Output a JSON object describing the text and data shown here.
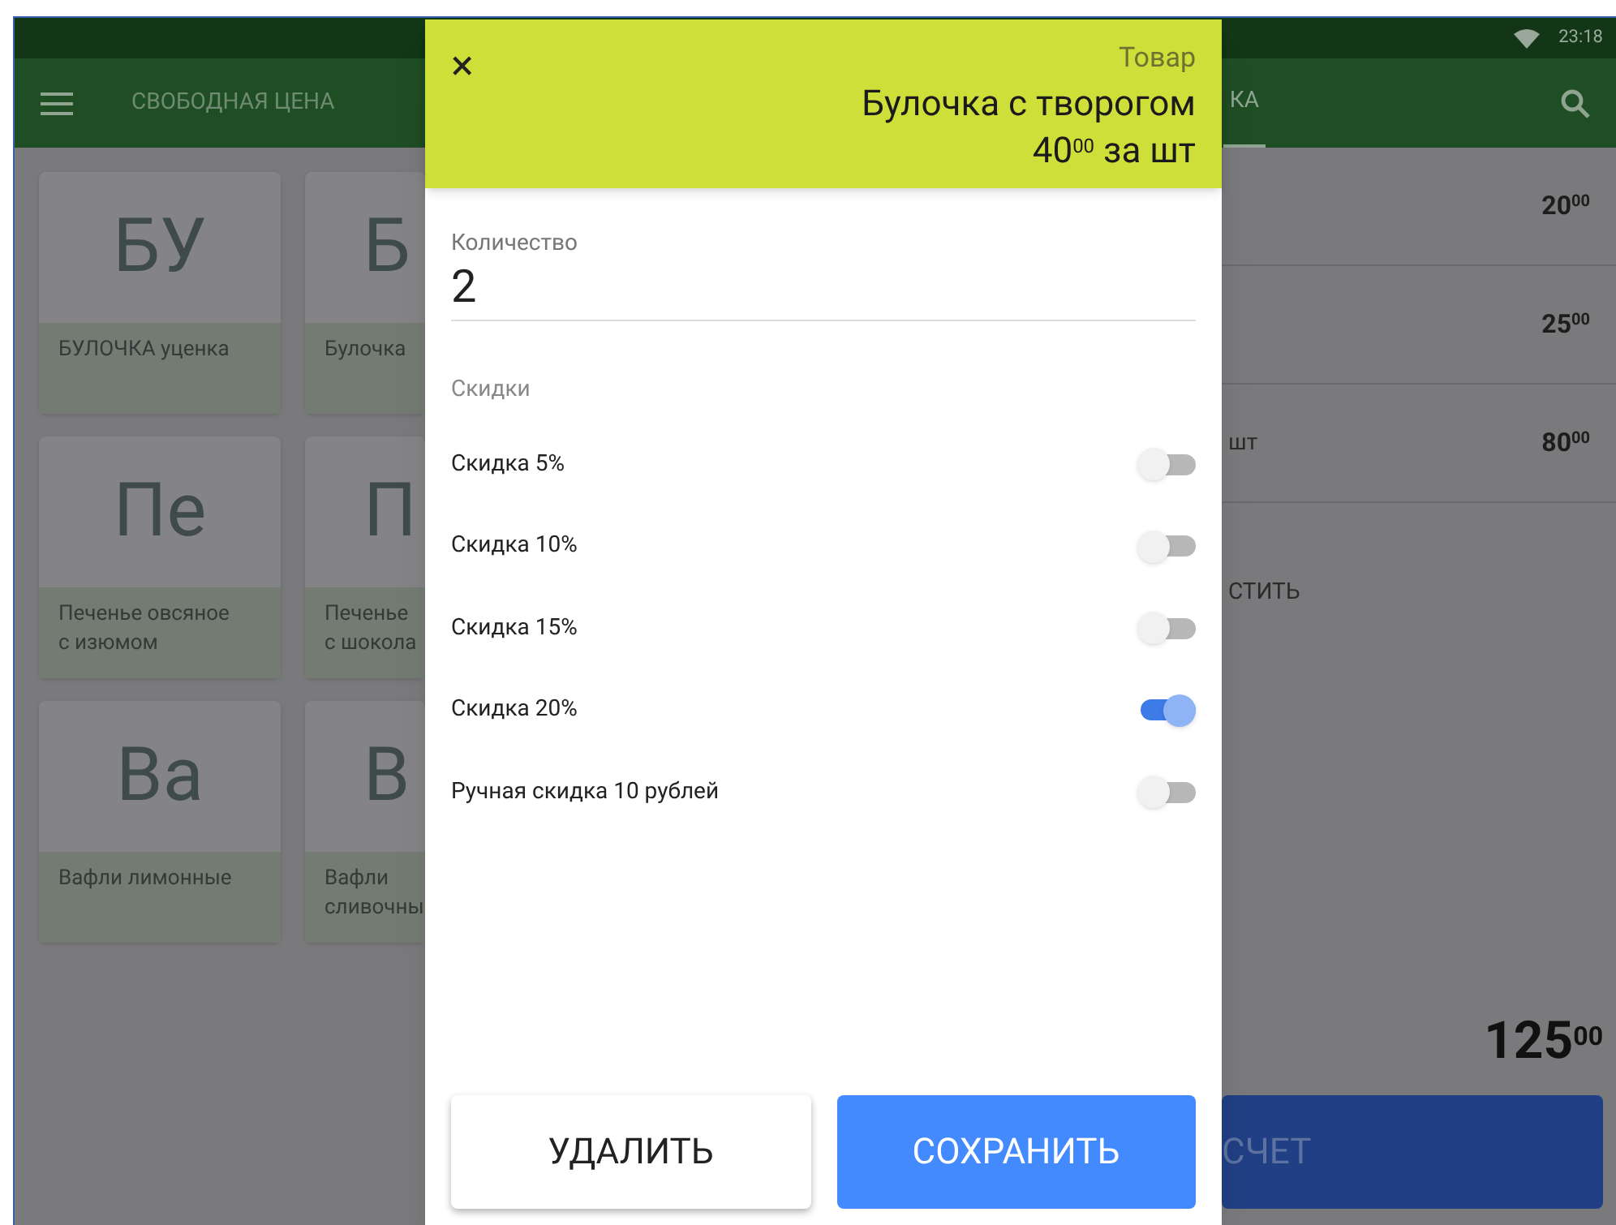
{
  "status_bar": {
    "time": "23:18"
  },
  "app_bar": {
    "tabs": [
      {
        "label": "СВОБОДНАЯ ЦЕНА",
        "selected": false
      },
      {
        "label": "КА",
        "selected": true
      }
    ]
  },
  "tiles": [
    {
      "initials": "БУ",
      "name": "БУЛОЧКА уценка",
      "partial": false
    },
    {
      "initials": "Б",
      "name": "Булочка",
      "partial": true
    },
    {
      "initials": "Пе",
      "name": "Печенье овсяное с изюмом",
      "partial": false
    },
    {
      "initials": "П",
      "name": "Печенье с шокола",
      "partial": true
    },
    {
      "initials": "Ва",
      "name": "Вафли лимонные",
      "partial": false
    },
    {
      "initials": "В",
      "name": "Вафли сливочны",
      "partial": true
    }
  ],
  "receipt": {
    "rows": [
      {
        "label": "",
        "price": "20$^{00}$"
      },
      {
        "label": "",
        "price": "25$^{00}$"
      },
      {
        "label": "шт",
        "price": "80$^{00}$"
      }
    ],
    "action": "СТИТЬ",
    "total": "125$^{00}$",
    "pay_button": "СЧЕТ"
  },
  "dialog": {
    "close": "×",
    "kind_label": "Товар",
    "product": "Булочка с творогом",
    "price": "40$^{00}$ за шт",
    "quantity": {
      "label": "Количество",
      "value": "2"
    },
    "discounts_title": "Скидки",
    "discounts": [
      {
        "label": "Скидка 5%",
        "on": false
      },
      {
        "label": "Скидка 10%",
        "on": false
      },
      {
        "label": "Скидка 15%",
        "on": false
      },
      {
        "label": "Скидка 20%",
        "on": true
      },
      {
        "label": "Ручная скидка 10 рублей",
        "on": false
      }
    ],
    "buttons": [
      {
        "label": "УДАЛИТЬ",
        "kind": "secondary"
      },
      {
        "label": "СОХРАНИТЬ",
        "kind": "primary"
      }
    ]
  }
}
